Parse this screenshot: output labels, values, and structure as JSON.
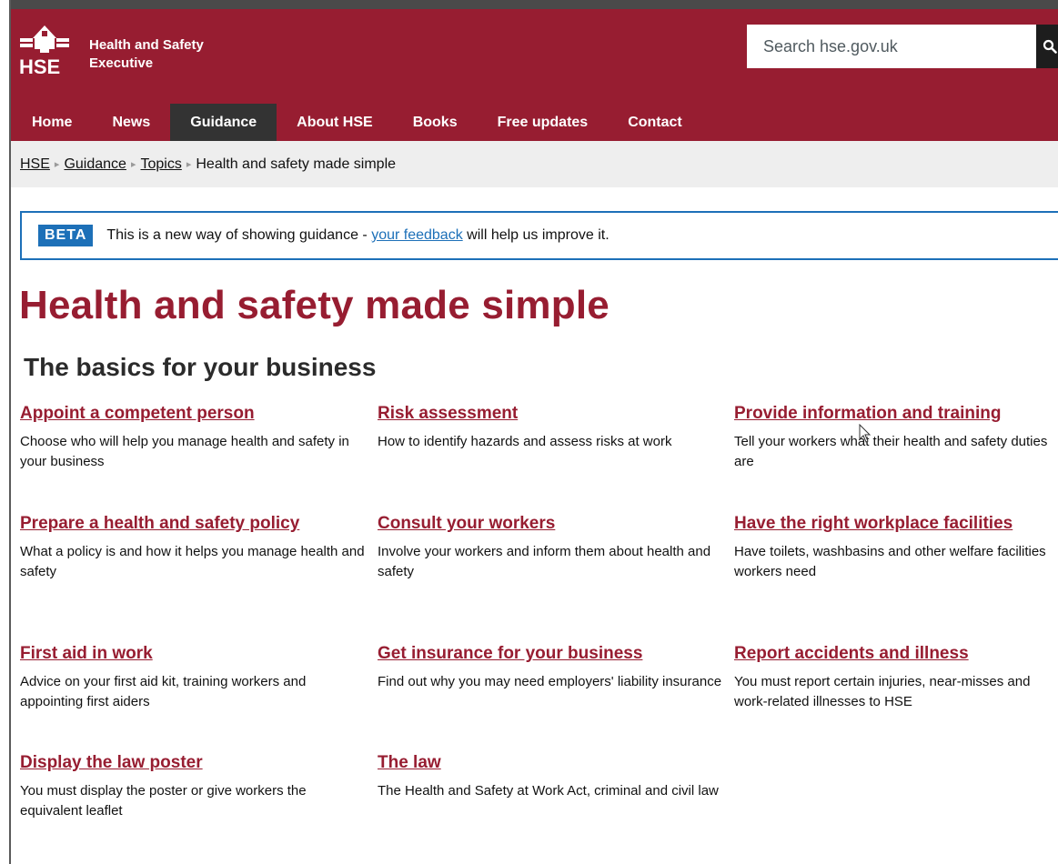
{
  "header": {
    "logo_text": "HSE",
    "org_name_line1": "Health and Safety",
    "org_name_line2": "Executive",
    "search_placeholder": "Search hse.gov.uk",
    "search_icon": "magnifier-icon"
  },
  "nav": {
    "items": [
      {
        "label": "Home"
      },
      {
        "label": "News"
      },
      {
        "label": "Guidance",
        "active": true
      },
      {
        "label": "About HSE"
      },
      {
        "label": "Books"
      },
      {
        "label": "Free updates"
      },
      {
        "label": "Contact"
      }
    ]
  },
  "breadcrumb": {
    "items": [
      "HSE",
      "Guidance",
      "Topics"
    ],
    "current": "Health and safety made simple",
    "separator": "▸"
  },
  "beta_banner": {
    "tag": "BETA",
    "text_before": "This is a new way of showing guidance - ",
    "link": "your feedback",
    "text_after": " will help us improve it."
  },
  "main": {
    "title": "Health and safety made simple",
    "subtitle": "The basics for your business",
    "cards": [
      {
        "title": "Appoint a competent person",
        "desc": "Choose who will help you manage health and safety in your business"
      },
      {
        "title": "Risk assessment",
        "desc": "How to identify hazards and assess risks at work"
      },
      {
        "title": "Provide information and training",
        "desc": "Tell your workers what their health and safety duties are"
      },
      {
        "title": "Prepare a health and safety policy",
        "desc": "What a policy is and how it helps you manage health and safety"
      },
      {
        "title": "Consult your workers",
        "desc": "Involve your workers and inform them about health and safety"
      },
      {
        "title": "Have the right workplace facilities",
        "desc": "Have toilets, washbasins and other welfare facilities workers need"
      },
      {
        "title": "First aid in work",
        "desc": "Advice on your first aid kit, training workers and appointing first aiders"
      },
      {
        "title": "Get insurance for your business",
        "desc": "Find out why you may need employers' liability insurance"
      },
      {
        "title": "Report accidents and illness",
        "desc": "You must report certain injuries, near-misses and work-related illnesses to HSE"
      },
      {
        "title": "Display the law poster",
        "desc": "You must display the poster or give workers the equivalent leaflet"
      },
      {
        "title": "The law",
        "desc": "The Health and Safety at Work Act, criminal and civil law"
      }
    ]
  },
  "colors": {
    "brand": "#971d31",
    "nav_active": "#333333",
    "breadcrumb_bg": "#eeeeee",
    "beta_blue": "#1d70b8"
  }
}
